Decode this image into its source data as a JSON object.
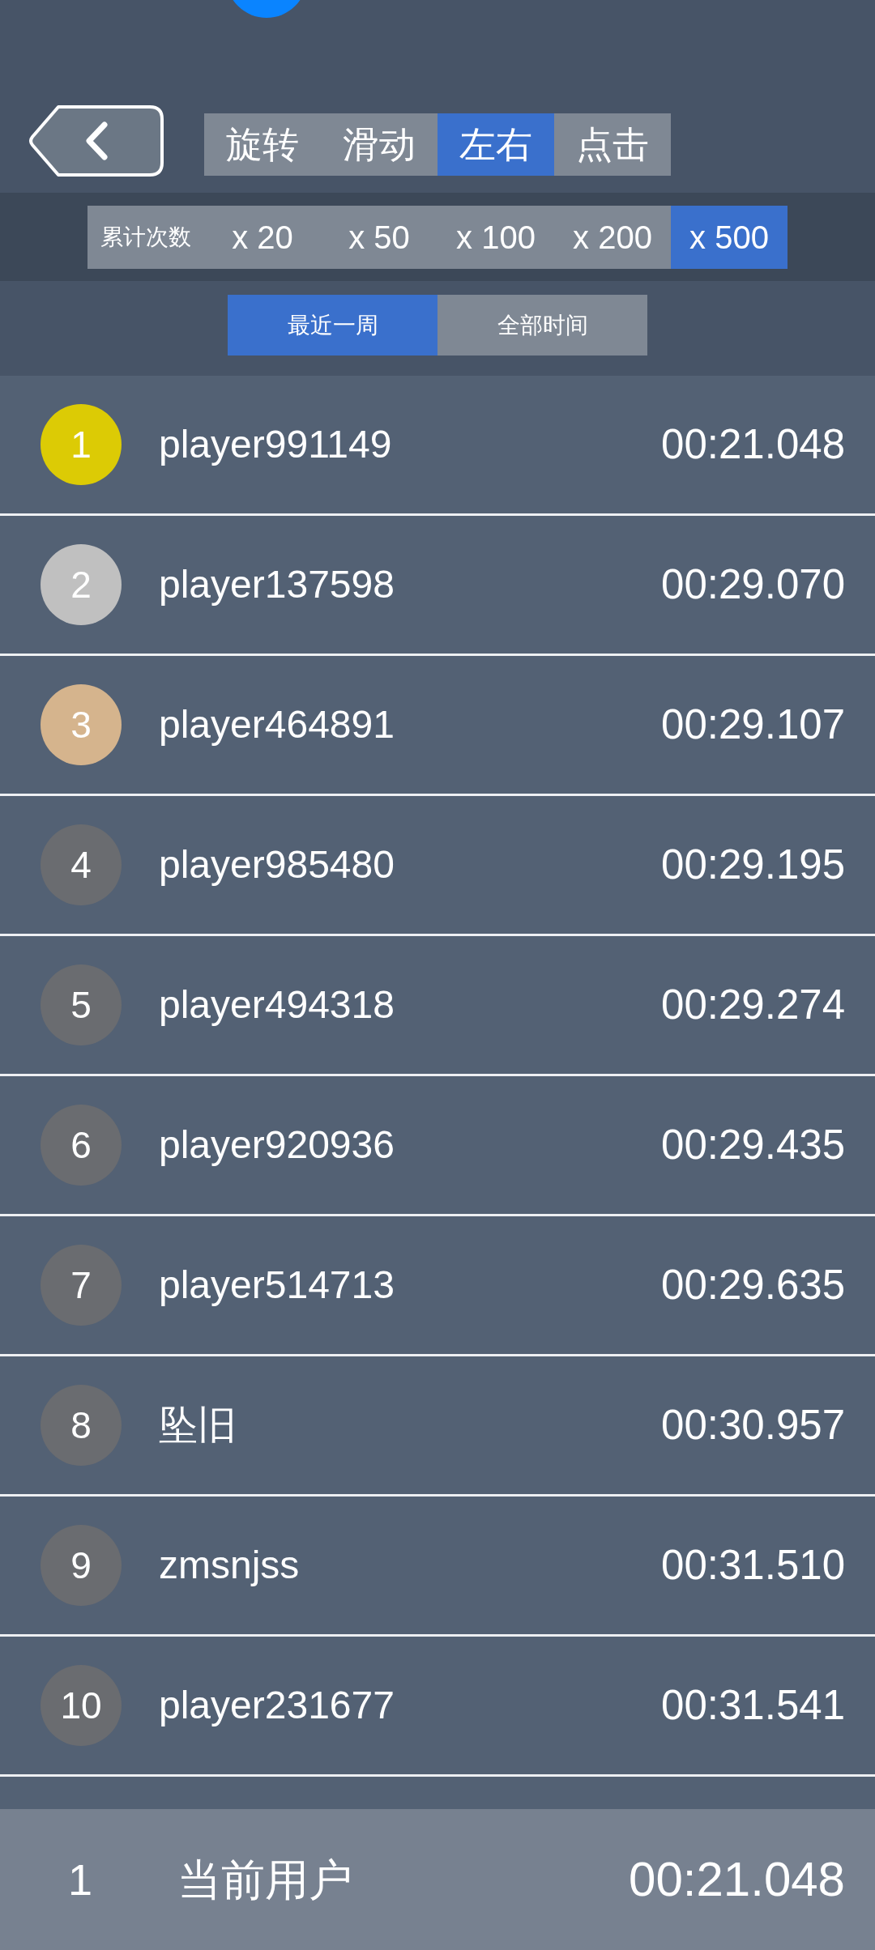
{
  "mode_tabs": [
    {
      "label": "旋转",
      "selected": false
    },
    {
      "label": "滑动",
      "selected": false
    },
    {
      "label": "左右",
      "selected": true
    },
    {
      "label": "点击",
      "selected": false
    }
  ],
  "count_filter": {
    "label": "累计次数",
    "options": [
      {
        "label": "x 20",
        "selected": false
      },
      {
        "label": "x 50",
        "selected": false
      },
      {
        "label": "x 100",
        "selected": false
      },
      {
        "label": "x 200",
        "selected": false
      },
      {
        "label": "x 500",
        "selected": true
      }
    ]
  },
  "period_tabs": [
    {
      "label": "最近一周",
      "selected": true
    },
    {
      "label": "全部时间",
      "selected": false
    }
  ],
  "leaderboard": [
    {
      "rank": "1",
      "name": "player991149",
      "time": "00:21.048",
      "color": "#dccb05"
    },
    {
      "rank": "2",
      "name": "player137598",
      "time": "00:29.070",
      "color": "#c0c0c0"
    },
    {
      "rank": "3",
      "name": "player464891",
      "time": "00:29.107",
      "color": "#d5b48d"
    },
    {
      "rank": "4",
      "name": "player985480",
      "time": "00:29.195",
      "color": "#6a6c70"
    },
    {
      "rank": "5",
      "name": "player494318",
      "time": "00:29.274",
      "color": "#6a6c70"
    },
    {
      "rank": "6",
      "name": "player920936",
      "time": "00:29.435",
      "color": "#6a6c70"
    },
    {
      "rank": "7",
      "name": "player514713",
      "time": "00:29.635",
      "color": "#6a6c70"
    },
    {
      "rank": "8",
      "name": "坠旧",
      "time": "00:30.957",
      "color": "#6a6c70"
    },
    {
      "rank": "9",
      "name": "zmsnjss",
      "time": "00:31.510",
      "color": "#6a6c70"
    },
    {
      "rank": "10",
      "name": "player231677",
      "time": "00:31.541",
      "color": "#6a6c70"
    }
  ],
  "current_user": {
    "rank": "1",
    "name": "当前用户",
    "time": "00:21.048"
  }
}
